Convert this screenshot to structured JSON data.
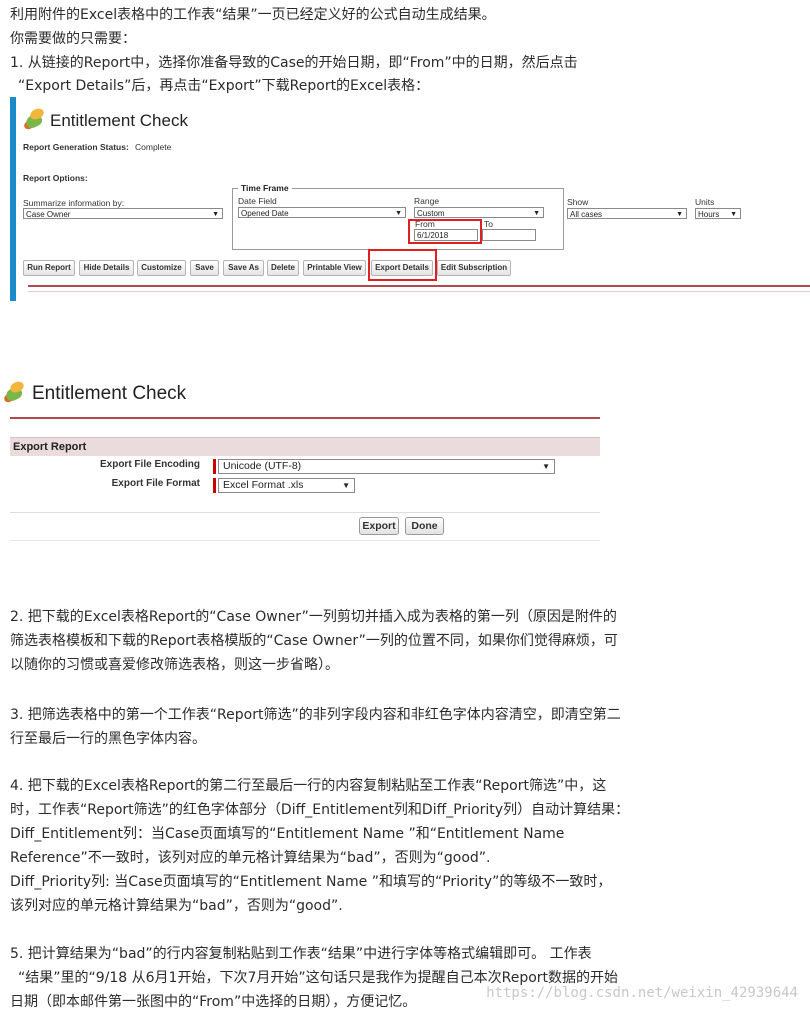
{
  "paragraphs": {
    "intro1": "利用附件的Excel表格中的工作表“结果”一页已经定义好的公式自动生成结果。",
    "intro2": "你需要做的只需要：",
    "step1_line1": "1. 从链接的Report中，选择你准备导致的Case的开始日期，即“From”中的日期，然后点击",
    "step1_line2": "“Export Details”后，再点击“Export”下载Report的Excel表格：",
    "step2_line1": "2. 把下载的Excel表格Report的“Case Owner”一列剪切并插入成为表格的第一列（原因是附件的",
    "step2_line2": "筛选表格模板和下载的Report表格模版的“Case Owner”一列的位置不同，如果你们觉得麻烦，可",
    "step2_line3": "以随你的习惯或喜爱修改筛选表格，则这一步省略）。",
    "step3_line1": "3. 把筛选表格中的第一个工作表“Report筛选”的非列字段内容和非红色字体内容清空，即清空第二",
    "step3_line2": "行至最后一行的黑色字体内容。",
    "step4_line1": "4. 把下载的Excel表格Report的第二行至最后一行的内容复制粘贴至工作表“Report筛选”中，这",
    "step4_line2": "时，工作表“Report筛选”的红色字体部分（Diff_Entitlement列和Diff_Priority列）自动计算结果：",
    "step4_line3": "Diff_Entitlement列：当Case页面填写的“Entitlement Name ”和“Entitlement Name",
    "step4_line4": "Reference”不一致时，该列对应的单元格计算结果为“bad”，否则为“good”.",
    "step4_line5": "Diff_Priority列: 当Case页面填写的“Entitlement Name ”和填写的“Priority”的等级不一致时，",
    "step4_line6": "该列对应的单元格计算结果为“bad”，否则为“good”.",
    "step5_line1": "5. 把计算结果为“bad”的行内容复制粘贴到工作表“结果”中进行字体等格式编辑即可。 工作表",
    "step5_line2": "“结果”里的“9/18 从6月1开始，下次7月开始”这句话只是我作为提醒自己本次Report数据的开始",
    "step5_line3": "日期（即本邮件第一张图中的“From”中选择的日期），方便记忆。"
  },
  "screenshot1": {
    "title": "Entitlement Check",
    "status_label": "Report Generation Status:",
    "status_value": "Complete",
    "options_label": "Report Options:",
    "summarize_label": "Summarize information by:",
    "summarize_value": "Case Owner",
    "time_frame_label": "Time Frame",
    "date_field_label": "Date Field",
    "date_field_value": "Opened Date",
    "range_label": "Range",
    "range_value": "Custom",
    "from_label": "From",
    "from_value": "6/1/2018",
    "to_label": "To",
    "to_value": "",
    "show_label": "Show",
    "show_value": "All cases",
    "units_label": "Units",
    "units_value": "Hours",
    "buttons": [
      "Run Report",
      "Hide Details",
      "Customize",
      "Save",
      "Save As",
      "Delete",
      "Printable View",
      "Export Details",
      "Edit Subscription"
    ]
  },
  "screenshot2": {
    "title": "Entitlement Check",
    "section_title": "Export Report",
    "encoding_label": "Export File Encoding",
    "encoding_value": "Unicode (UTF-8)",
    "format_label": "Export File Format",
    "format_value": "Excel Format .xls",
    "export_button": "Export",
    "done_button": "Done"
  },
  "watermark": "https://blog.csdn.net/weixin_42939644",
  "colors": {
    "highlight": "#e02020",
    "accent_bar": "#1b8cc9",
    "sf_red": "#b3494b"
  }
}
